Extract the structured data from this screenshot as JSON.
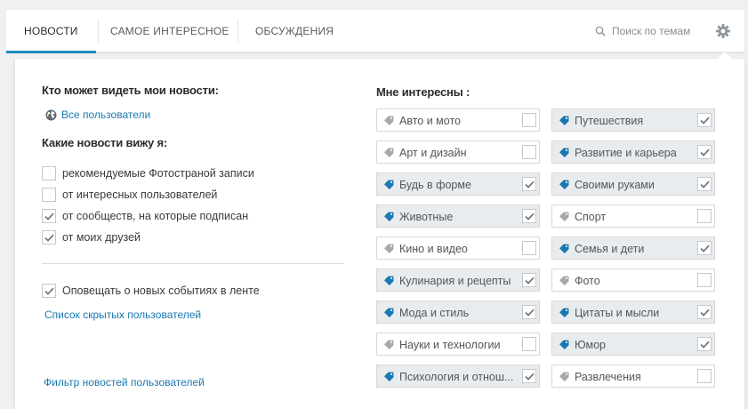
{
  "nav": {
    "tabs": [
      {
        "label": "НОВОСТИ",
        "active": true
      },
      {
        "label": "САМОЕ ИНТЕРЕСНОЕ",
        "active": false
      },
      {
        "label": "ОБСУЖДЕНИЯ",
        "active": false
      }
    ],
    "search_placeholder": "Поиск по темам",
    "search_icon": "search-icon",
    "settings_icon": "gear-icon"
  },
  "panel": {
    "who_title": "Кто может видеть мои новости:",
    "visibility_link": "Все пользователи",
    "which_title": "Какие новости вижу я:",
    "options": [
      {
        "label": "рекомендуемые Фотостраной записи",
        "checked": false
      },
      {
        "label": "от интересных пользователей",
        "checked": false
      },
      {
        "label": "от сообществ, на которые подписан",
        "checked": true
      },
      {
        "label": "от моих друзей",
        "checked": true
      }
    ],
    "notify": {
      "label": "Оповещать о новых событиях в ленте",
      "checked": true
    },
    "hidden_users_link": "Список скрытых пользователей",
    "filter_link": "Фильтр новостей пользователей",
    "interests_title": "Мне интересны :",
    "interests": [
      {
        "label": "Авто и мото",
        "checked": false
      },
      {
        "label": "Путешествия",
        "checked": true
      },
      {
        "label": "Арт и дизайн",
        "checked": false
      },
      {
        "label": "Развитие и карьера",
        "checked": true
      },
      {
        "label": "Будь в форме",
        "checked": true
      },
      {
        "label": "Своими руками",
        "checked": true
      },
      {
        "label": "Животные",
        "checked": true
      },
      {
        "label": "Спорт",
        "checked": false
      },
      {
        "label": "Кино и видео",
        "checked": false
      },
      {
        "label": "Семья и дети",
        "checked": true
      },
      {
        "label": "Кулинария и рецепты",
        "checked": true
      },
      {
        "label": "Фото",
        "checked": false
      },
      {
        "label": "Мода и стиль",
        "checked": true
      },
      {
        "label": "Цитаты и мысли",
        "checked": true
      },
      {
        "label": "Науки и технологии",
        "checked": false
      },
      {
        "label": "Юмор",
        "checked": true
      },
      {
        "label": "Психология и отнош...",
        "checked": true
      },
      {
        "label": "Развлечения",
        "checked": false
      }
    ]
  },
  "colors": {
    "accent": "#1f8ac0",
    "link": "#1a78b0",
    "tag_on": "#1a78b0",
    "tag_off": "#a8a8a8"
  }
}
